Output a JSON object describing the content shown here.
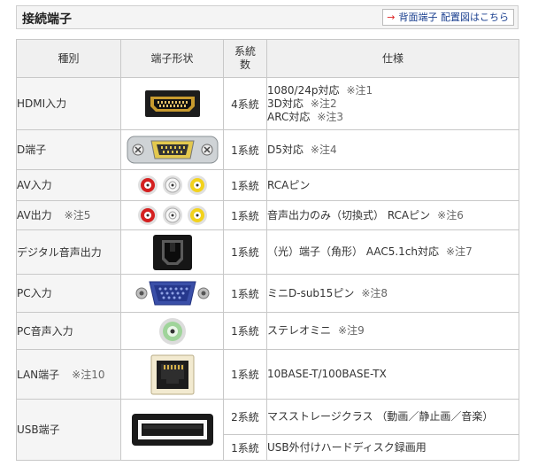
{
  "header": {
    "title": "接続端子",
    "link": "背面端子 配置図はこちら"
  },
  "table": {
    "col_type": "種別",
    "col_shape": "端子形状",
    "col_sys_1": "系統",
    "col_sys_2": "数",
    "col_spec": "仕様"
  },
  "rows": {
    "hdmi": {
      "type": "HDMI入力",
      "sys": "4系統",
      "spec1": "1080/24p対応",
      "note1": "※注1",
      "spec2": "3D対応",
      "note2": "※注2",
      "spec3": "ARC対応",
      "note3": "※注3"
    },
    "d": {
      "type": "D端子",
      "sys": "1系統",
      "spec": "D5対応",
      "note": "※注4"
    },
    "avin": {
      "type": "AV入力",
      "sys": "1系統",
      "spec": "RCAピン"
    },
    "avout": {
      "type": "AV出力",
      "type_note": "※注5",
      "sys": "1系統",
      "spec": "音声出力のみ（切換式） RCAピン",
      "note": "※注6"
    },
    "digital": {
      "type": "デジタル音声出力",
      "sys": "1系統",
      "spec": "（光）端子（角形） AAC5.1ch対応",
      "note": "※注7"
    },
    "pc": {
      "type": "PC入力",
      "sys": "1系統",
      "spec": "ミニD-sub15ピン",
      "note": "※注8"
    },
    "pcaudio": {
      "type": "PC音声入力",
      "sys": "1系統",
      "spec": "ステレオミニ",
      "note": "※注9"
    },
    "lan": {
      "type": "LAN端子",
      "type_note": "※注10",
      "sys": "1系統",
      "spec": "10BASE-T/100BASE-TX"
    },
    "usb": {
      "type": "USB端子",
      "sys1": "2系統",
      "spec1": "マスストレージクラス （動画／静止画／音楽）",
      "sys2": "1系統",
      "spec2": "USB外付けハードディスク録画用"
    }
  },
  "icons": {
    "hdmi": "hdmi-port-icon",
    "d": "d-terminal-port-icon",
    "rca": "rca-jacks-icon",
    "optical": "optical-port-icon",
    "vga": "vga-port-icon",
    "mini": "stereo-mini-jack-icon",
    "lan": "lan-port-icon",
    "usb": "usb-port-icon"
  },
  "colors": {
    "link_arrow": "#dd2222",
    "link_text": "#1a3f8f",
    "header_bg": "#f0f0f0"
  }
}
